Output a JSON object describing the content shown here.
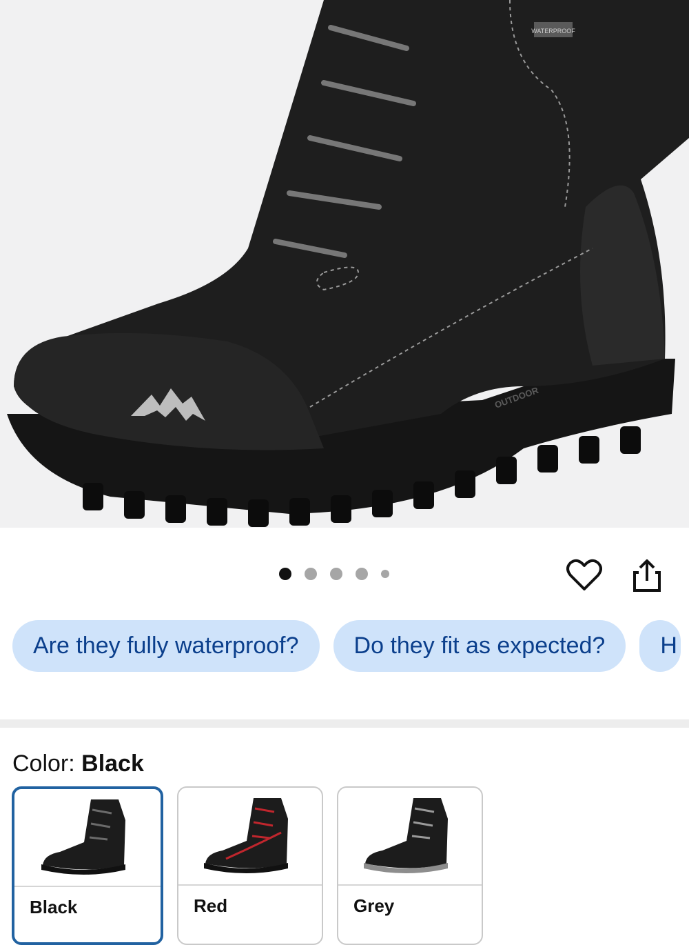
{
  "product_image": {
    "alt": "Black winter snow boot",
    "badge_text": "OUTDOOR",
    "tongue_label": "WATERPROOF",
    "accent": "#8a8a8a"
  },
  "carousel": {
    "total": 5,
    "active_index": 0
  },
  "actions": {
    "favorite_icon": "heart-icon",
    "share_icon": "share-icon"
  },
  "questions": [
    {
      "label": "Are they fully waterproof?"
    },
    {
      "label": "Do they fit as expected?"
    },
    {
      "label": "H"
    }
  ],
  "color": {
    "prefix": "Color: ",
    "selected": "Black",
    "options": [
      {
        "label": "Black",
        "accent": "#6b6b6b"
      },
      {
        "label": "Red",
        "accent": "#c0262d"
      },
      {
        "label": "Grey",
        "accent": "#9a9a9a"
      }
    ]
  },
  "colors": {
    "chip_bg": "#cfe3fa",
    "chip_text": "#0b3f8c",
    "selected_border": "#2162a1"
  }
}
